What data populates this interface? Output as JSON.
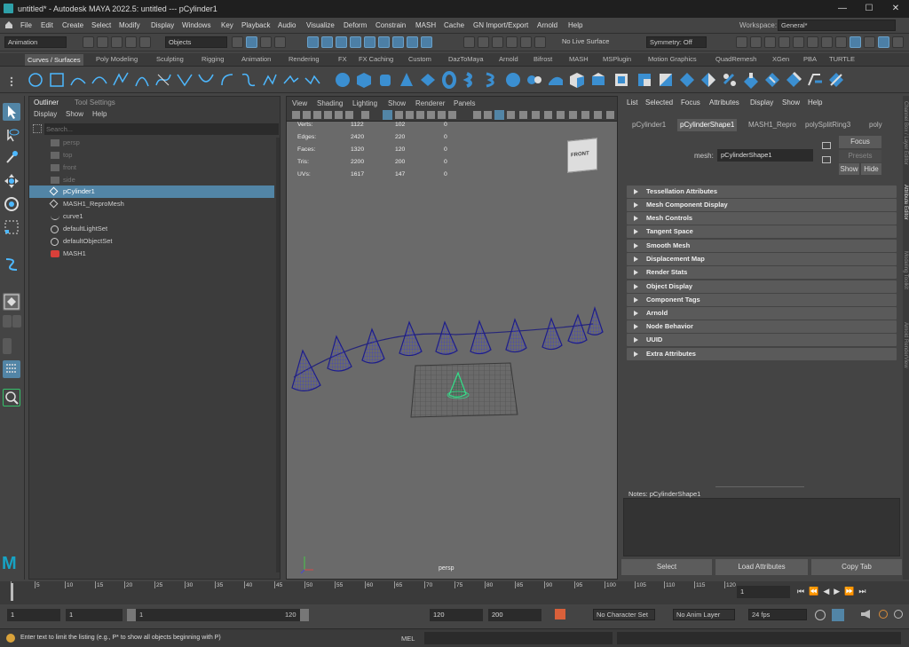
{
  "title": {
    "app_title": "untitled* - Autodesk MAYA 2022.5: untitled   ---   pCylinder1",
    "minimize": "—",
    "maximize": "☐",
    "close": "✕"
  },
  "menubar": {
    "items": [
      "File",
      "Edit",
      "Create",
      "Select",
      "Modify",
      "Display",
      "Windows",
      "Key",
      "Playback",
      "Audio",
      "Visualize",
      "Deform",
      "Constrain",
      "MASH",
      "Cache",
      "GN Import/Export",
      "Arnold",
      "Help"
    ],
    "workspace_label": "Workspace:",
    "workspace_value": "General*"
  },
  "statusline": {
    "mode": "Animation",
    "objects": "Objects",
    "live_surface": "No Live Surface",
    "symmetry": "Symmetry: Off"
  },
  "shelf": {
    "tabs": [
      "Curves / Surfaces",
      "Poly Modeling",
      "Sculpting",
      "Rigging",
      "Animation",
      "Rendering",
      "FX",
      "FX Caching",
      "Custom",
      "DazToMaya",
      "Arnold",
      "Bifrost",
      "MASH",
      "MSPlugin",
      "Motion Graphics",
      "QuadRemesh",
      "XGen",
      "PBA",
      "TURTLE"
    ]
  },
  "outliner": {
    "tab_outliner": "Outliner",
    "tab_tool_settings": "Tool Settings",
    "menu_display": "Display",
    "menu_show": "Show",
    "menu_help": "Help",
    "search_placeholder": "Search...",
    "items": [
      "persp",
      "top",
      "front",
      "side",
      "pCylinder1",
      "MASH1_ReproMesh",
      "curve1",
      "defaultLightSet",
      "defaultObjectSet",
      "MASH1"
    ]
  },
  "viewport": {
    "menus": [
      "View",
      "Shading",
      "Lighting",
      "Show",
      "Renderer",
      "Panels"
    ],
    "stats": [
      [
        "Verts:",
        "1122",
        "102",
        "0"
      ],
      [
        "Edges:",
        "2420",
        "220",
        "0"
      ],
      [
        "Faces:",
        "1320",
        "120",
        "0"
      ],
      [
        "Tris:",
        "2200",
        "200",
        "0"
      ],
      [
        "UVs:",
        "1617",
        "147",
        "0"
      ]
    ],
    "camera": "persp",
    "viewcube": "FRONT"
  },
  "attr": {
    "menus": [
      "List",
      "Selected",
      "Focus",
      "Attributes",
      "Display",
      "Show",
      "Help"
    ],
    "tabs": [
      "pCylinder1",
      "pCylinderShape1",
      "MASH1_Repro",
      "polySplitRing3",
      "poly"
    ],
    "mesh_label": "mesh:",
    "mesh_value": "pCylinderShape1",
    "focus": "Focus",
    "presets": "Presets",
    "show": "Show",
    "hide": "Hide",
    "sections": [
      "Tessellation Attributes",
      "Mesh Component Display",
      "Mesh Controls",
      "Tangent Space",
      "Smooth Mesh",
      "Displacement Map",
      "Render Stats",
      "Object Display",
      "Component Tags",
      "Arnold",
      "Node Behavior",
      "UUID",
      "Extra Attributes"
    ],
    "notes": "Notes:  pCylinderShape1",
    "select": "Select",
    "load_attributes": "Load Attributes",
    "copy_tab": "Copy Tab",
    "side_tabs": [
      "Attribute Editor",
      "Channel Box / Layer Editor",
      "Modeling Toolkit",
      "Arnold RenderView"
    ]
  },
  "time": {
    "ticks": [
      "1",
      "5",
      "10",
      "15",
      "20",
      "25",
      "30",
      "35",
      "40",
      "45",
      "50",
      "55",
      "60",
      "65",
      "70",
      "75",
      "80",
      "85",
      "90",
      "95",
      "100",
      "105",
      "110",
      "115",
      "120"
    ],
    "current": "1"
  },
  "range": {
    "start": "1",
    "start2": "1",
    "slider_start": "1",
    "slider_end": "120",
    "end": "120",
    "end2": "200",
    "character": "No Character Set",
    "anim_layer": "No Anim Layer",
    "fps": "24 fps"
  },
  "help": {
    "text": "Enter text to limit the listing (e.g., P* to show all objects beginning with P)",
    "mel": "MEL"
  },
  "colors": {
    "accent": "#5285a6",
    "cone": "#1d1d8a",
    "selected_cone": "#34e08a"
  }
}
